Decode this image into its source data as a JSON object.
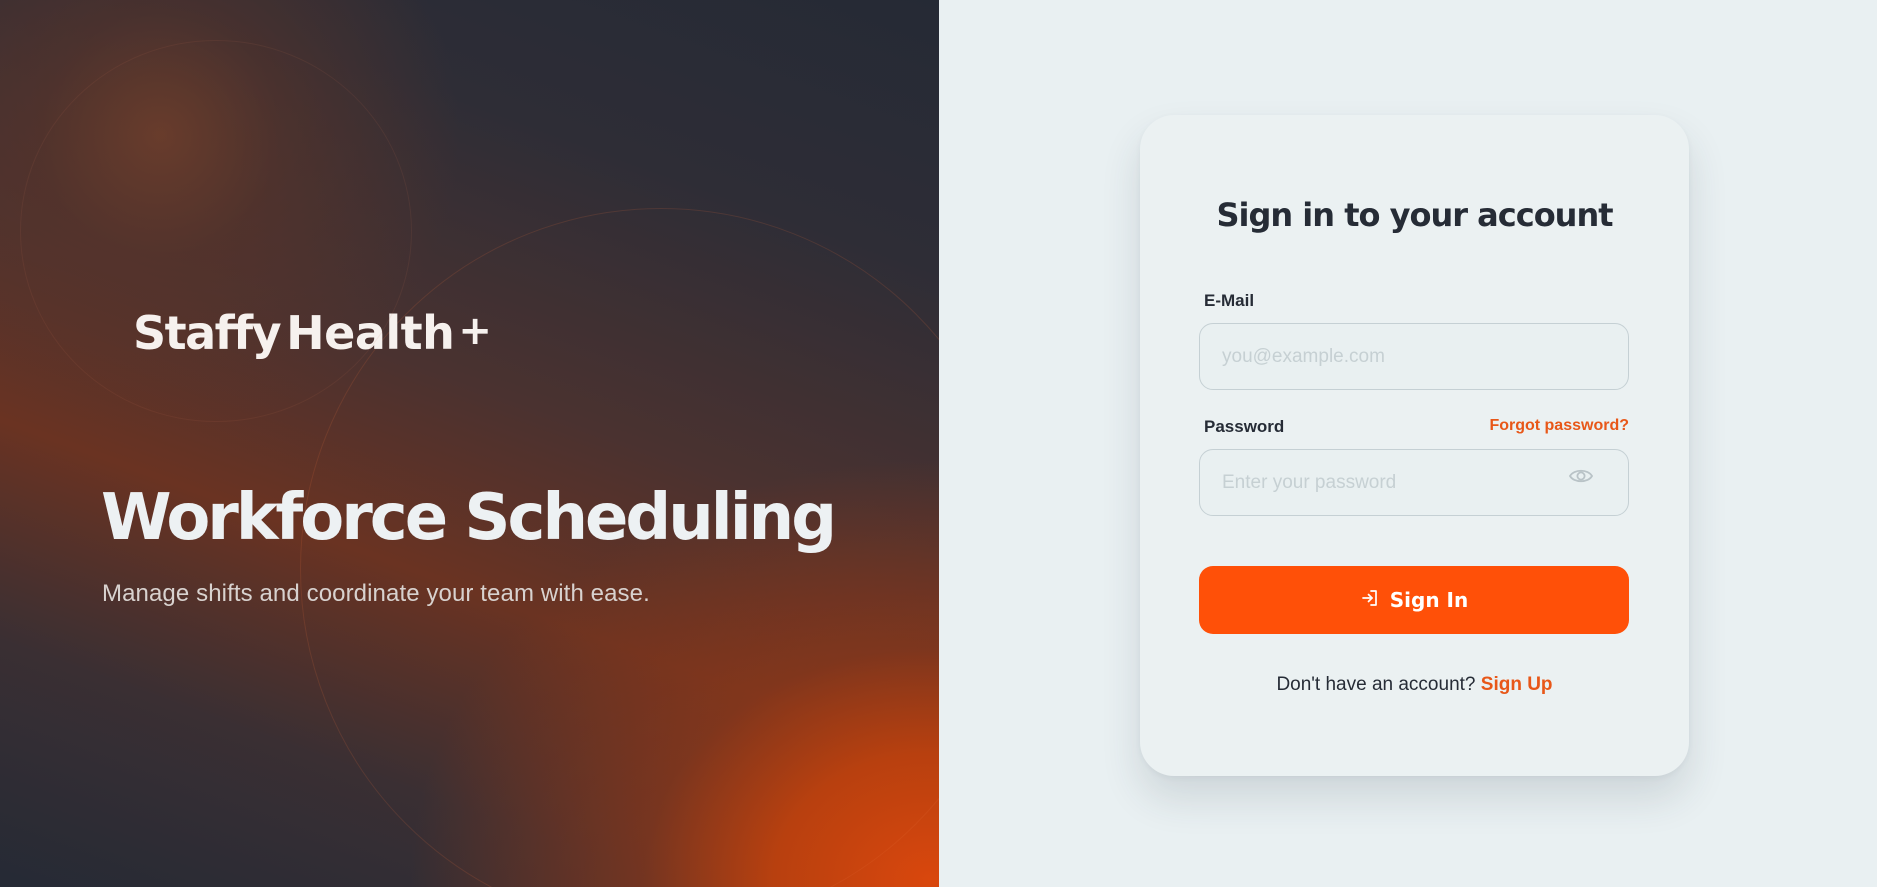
{
  "brand": {
    "name_part1": "Staffy",
    "name_part2": "Health",
    "name_part3": "+"
  },
  "hero": {
    "title": "Workforce Scheduling",
    "subtitle": "Manage shifts and coordinate your team with ease."
  },
  "login": {
    "title": "Sign in to your account",
    "email_label": "E-Mail",
    "email_placeholder": "you@example.com",
    "email_value": "",
    "password_label": "Password",
    "forgot_label": "Forgot password?",
    "password_placeholder": "Enter your password",
    "password_value": "",
    "password_toggle_icon": "eye-icon",
    "submit_icon": "login-icon",
    "submit_label": "Sign In",
    "signup_prompt": "Don't have an account?",
    "signup_link": "Sign Up"
  },
  "colors": {
    "accent": "#ff5008",
    "link": "#e85718",
    "text_dark": "#262c36",
    "page_bg": "#e9f0f2"
  }
}
